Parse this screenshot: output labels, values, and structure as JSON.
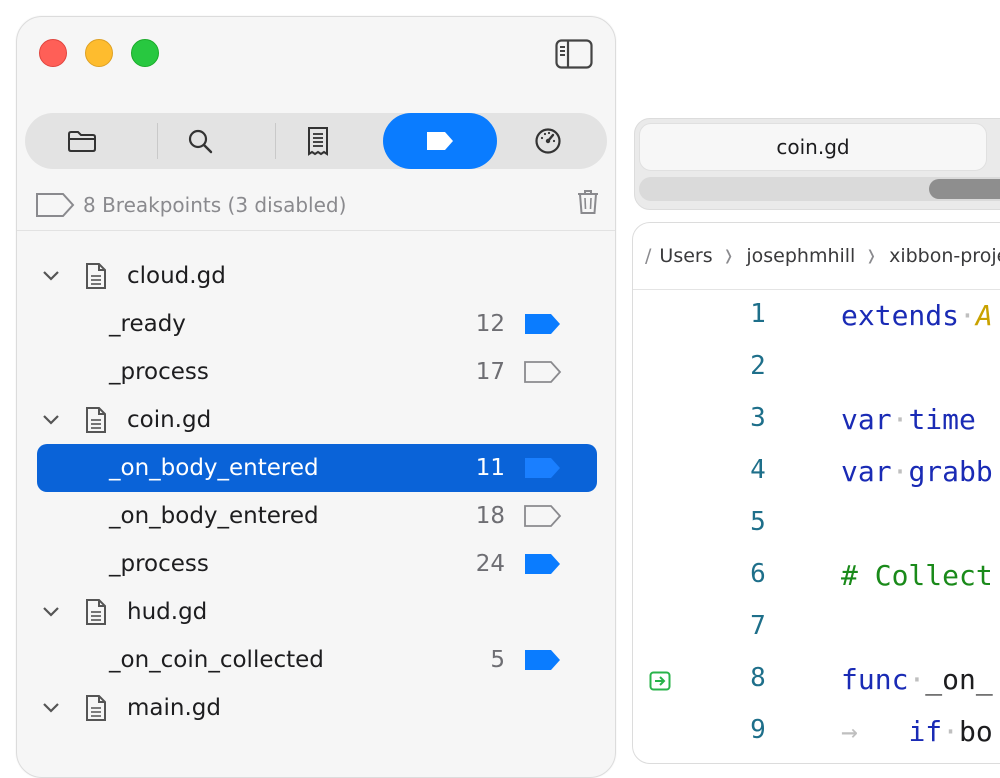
{
  "colors": {
    "accent": "#0a7cff",
    "selection": "#0a63d8",
    "keyword": "#1a2bb5",
    "comment": "#1a8a1a",
    "line_number": "#1e6f8a"
  },
  "toolbar": {
    "segments": [
      "folder-icon",
      "search-icon",
      "document-icon",
      "breakpoint-icon",
      "gauge-icon"
    ],
    "active_segment": "breakpoint-icon"
  },
  "breakpoints": {
    "summary": "8 Breakpoints (3 disabled)",
    "files": [
      {
        "name": "cloud.gd",
        "items": [
          {
            "function": "_ready",
            "line": "12",
            "enabled": true
          },
          {
            "function": "_process",
            "line": "17",
            "enabled": false
          }
        ]
      },
      {
        "name": "coin.gd",
        "items": [
          {
            "function": "_on_body_entered",
            "line": "11",
            "enabled": true,
            "selected": true
          },
          {
            "function": "_on_body_entered",
            "line": "18",
            "enabled": false
          },
          {
            "function": "_process",
            "line": "24",
            "enabled": true
          }
        ]
      },
      {
        "name": "hud.gd",
        "items": [
          {
            "function": "_on_coin_collected",
            "line": "5",
            "enabled": true
          }
        ]
      },
      {
        "name": "main.gd",
        "items": []
      }
    ]
  },
  "editor": {
    "tab_label": "coin.gd",
    "breadcrumb": [
      "/",
      "Users",
      "josephmhill",
      "xibbon-proje"
    ],
    "line_numbers": [
      "1",
      "2",
      "3",
      "4",
      "5",
      "6",
      "7",
      "8",
      "9"
    ],
    "lines": {
      "l1a": "extends",
      "l1b": "A",
      "l3a": "var",
      "l3b": "time",
      "l4a": "var",
      "l4b": "grabb",
      "l6": "# Collect",
      "l8a": "func",
      "l8b": "_on_",
      "l9a": "if",
      "l9b": "bo"
    }
  }
}
